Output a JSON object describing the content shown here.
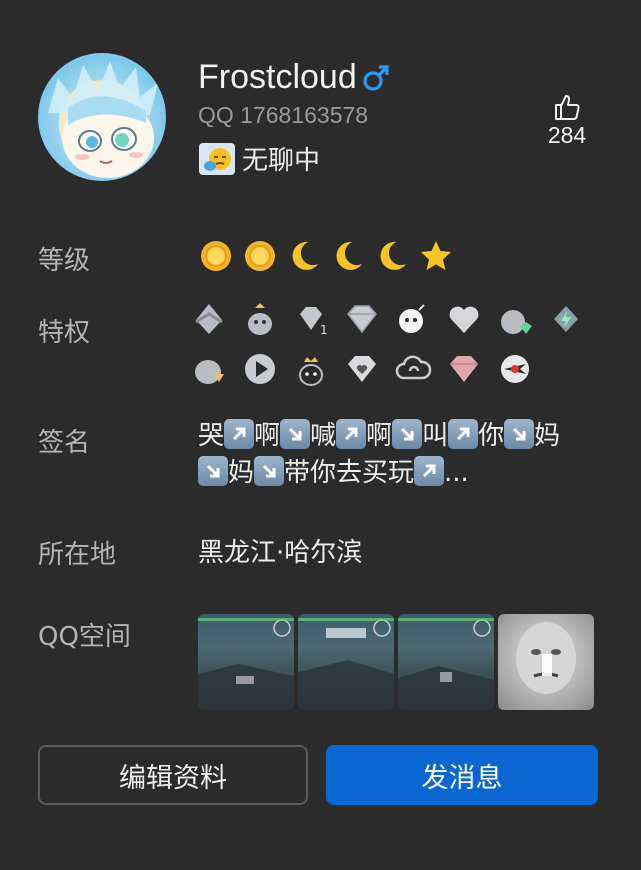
{
  "profile": {
    "nickname": "Frostcloud",
    "qq_id": "QQ 1768163578",
    "status_text": "无聊中",
    "likes": "284"
  },
  "labels": {
    "level": "等级",
    "privileges": "特权",
    "signature": "签名",
    "location": "所在地",
    "qzone": "QQ空间"
  },
  "level_icons": [
    "sun-icon",
    "sun-icon",
    "moon-icon",
    "moon-icon",
    "moon-icon",
    "star-icon"
  ],
  "privilege_icons": [
    "vip-crown-icon",
    "qq-penguin-crown-icon",
    "diamond-1-icon",
    "diamond-icon",
    "bomb-icon",
    "heart-icon",
    "penguin-gem-icon",
    "lightning-gem-icon",
    "penguin-gold-icon",
    "play-icon",
    "penguin-crown-icon",
    "diamond-heart-icon",
    "cloud-icon",
    "pink-diamond-icon",
    "cf-logo-icon"
  ],
  "signature": {
    "segments": [
      "哭",
      "啊",
      "喊",
      "啊",
      "叫",
      "你",
      "妈",
      "妈",
      "带你去买玩",
      "..."
    ],
    "arrows": [
      "up-right",
      "down-right",
      "up-right",
      "down-right",
      "up-right",
      "down-right",
      "down-right",
      "down-right",
      "up-right"
    ]
  },
  "location": "黑龙江·哈尔滨",
  "qzone_photos": [
    "game-screenshot",
    "game-screenshot",
    "game-screenshot",
    "face-meme"
  ],
  "buttons": {
    "edit": "编辑资料",
    "message": "发消息"
  },
  "colors": {
    "background": "#2b2b2b",
    "primary_button": "#0a66d3",
    "label": "#b4b4b4",
    "gender_male": "#2b9bf0"
  }
}
